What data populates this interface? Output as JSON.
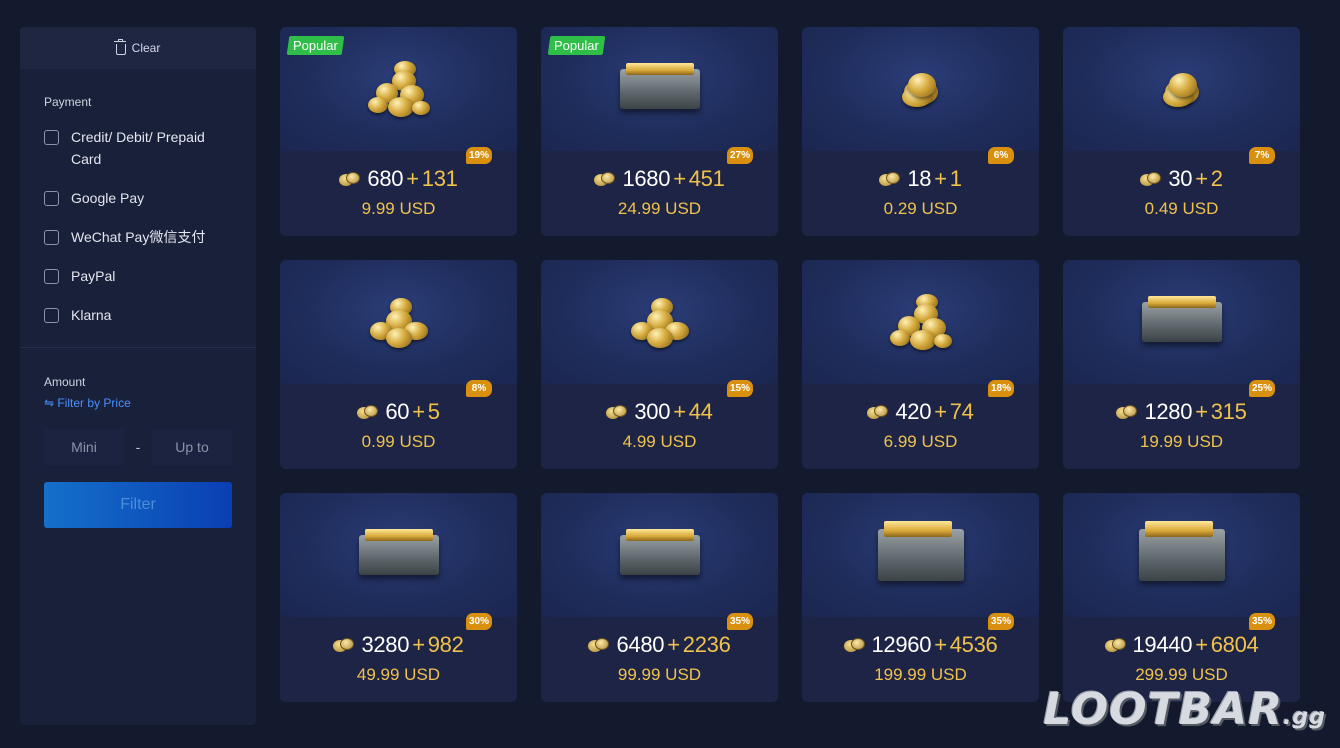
{
  "sidebar": {
    "clear_label": "Clear",
    "payment_title": "Payment",
    "payment_methods": [
      {
        "label": "Credit/ Debit/ Prepaid Card",
        "checked": false
      },
      {
        "label": "Google Pay",
        "checked": false
      },
      {
        "label": "WeChat Pay微信支付",
        "checked": false
      },
      {
        "label": "PayPal",
        "checked": false
      },
      {
        "label": "Klarna",
        "checked": false
      }
    ],
    "amount_title": "Amount",
    "filter_by_price": "⇋ Filter by Price",
    "min_placeholder": "Mini",
    "max_placeholder": "Up to",
    "range_separator": "-",
    "filter_button": "Filter"
  },
  "products": [
    {
      "coins": "680",
      "plus": "+",
      "bonus": "131",
      "price": "9.99 USD",
      "discount": "19%",
      "badge": "Popular",
      "art": "coins-large"
    },
    {
      "coins": "1680",
      "plus": "+",
      "bonus": "451",
      "price": "24.99 USD",
      "discount": "27%",
      "badge": "Popular",
      "art": "chest"
    },
    {
      "coins": "18",
      "plus": "+",
      "bonus": "1",
      "price": "0.29 USD",
      "discount": "6%",
      "badge": "",
      "art": "coins-small"
    },
    {
      "coins": "30",
      "plus": "+",
      "bonus": "2",
      "price": "0.49 USD",
      "discount": "7%",
      "badge": "",
      "art": "coins-small"
    },
    {
      "coins": "60",
      "plus": "+",
      "bonus": "5",
      "price": "0.99 USD",
      "discount": "8%",
      "badge": "",
      "art": "coins-medium"
    },
    {
      "coins": "300",
      "plus": "+",
      "bonus": "44",
      "price": "4.99 USD",
      "discount": "15%",
      "badge": "",
      "art": "coins-medium"
    },
    {
      "coins": "420",
      "plus": "+",
      "bonus": "74",
      "price": "6.99 USD",
      "discount": "18%",
      "badge": "",
      "art": "coins-large"
    },
    {
      "coins": "1280",
      "plus": "+",
      "bonus": "315",
      "price": "19.99 USD",
      "discount": "25%",
      "badge": "",
      "art": "chest"
    },
    {
      "coins": "3280",
      "plus": "+",
      "bonus": "982",
      "price": "49.99 USD",
      "discount": "30%",
      "badge": "",
      "art": "chest"
    },
    {
      "coins": "6480",
      "plus": "+",
      "bonus": "2236",
      "price": "99.99 USD",
      "discount": "35%",
      "badge": "",
      "art": "chest"
    },
    {
      "coins": "12960",
      "plus": "+",
      "bonus": "4536",
      "price": "199.99 USD",
      "discount": "35%",
      "badge": "",
      "art": "chest-big"
    },
    {
      "coins": "19440",
      "plus": "+",
      "bonus": "6804",
      "price": "299.99 USD",
      "discount": "35%",
      "badge": "",
      "art": "chest-big"
    }
  ],
  "watermark": {
    "main": "LOOTBAR",
    "suffix": ".gg"
  },
  "colors": {
    "accent_gold": "#f0c24c",
    "popular_green": "#2fbf48",
    "discount_orange": "#d9900f",
    "link_blue": "#4a90ff"
  }
}
